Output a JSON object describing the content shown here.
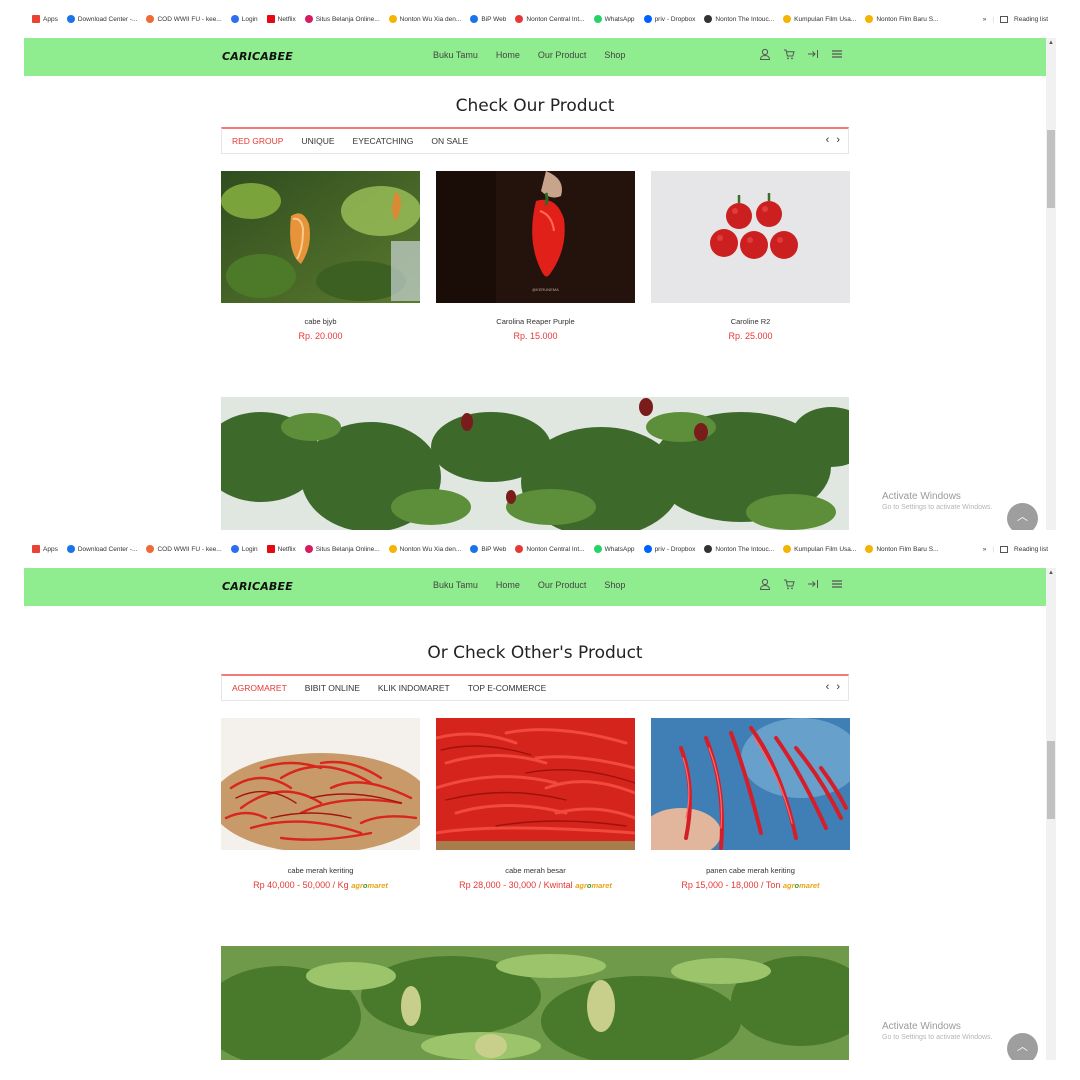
{
  "bookmarks": [
    {
      "label": "Apps",
      "icon": "apps-grid-icon",
      "color": "#ea4335"
    },
    {
      "label": "Download Center -...",
      "icon": "download-center-icon",
      "color": "#1a73e8"
    },
    {
      "label": "COD WWII FU - kee...",
      "icon": "cod-icon",
      "color": "#f06a35"
    },
    {
      "label": "Login",
      "icon": "login-icon",
      "color": "#2b6ef3"
    },
    {
      "label": "Netflix",
      "icon": "netflix-icon",
      "color": "#e50914"
    },
    {
      "label": "Situs Belanja Online...",
      "icon": "shop-icon",
      "color": "#d81b60"
    },
    {
      "label": "Nonton Wu Xia den...",
      "icon": "wuxia-icon",
      "color": "#f4b400"
    },
    {
      "label": "BiP Web",
      "icon": "bip-icon",
      "color": "#1a73e8"
    },
    {
      "label": "Nonton Central Int...",
      "icon": "central-icon",
      "color": "#e53935"
    },
    {
      "label": "WhatsApp",
      "icon": "whatsapp-icon",
      "color": "#25d366"
    },
    {
      "label": "priv - Dropbox",
      "icon": "dropbox-icon",
      "color": "#0061ff"
    },
    {
      "label": "Nonton The Intouc...",
      "icon": "intouch-icon",
      "color": "#333333"
    },
    {
      "label": "Kumpulan Film Usa...",
      "icon": "film-icon",
      "color": "#f4b400"
    },
    {
      "label": "Nonton Film Baru S...",
      "icon": "film-baru-icon",
      "color": "#f4b400"
    }
  ],
  "bookmarks_more": "»",
  "reading_list": "Reading list",
  "brand": "CARICABEE",
  "nav_links": [
    "Buku Tamu",
    "Home",
    "Our Product",
    "Shop"
  ],
  "nav_icons": [
    "user-icon",
    "cart-icon",
    "login-arrow-icon",
    "menu-icon"
  ],
  "activate": {
    "title": "Activate Windows",
    "sub": "Go to Settings to activate Windows."
  },
  "section1": {
    "title": "Check Our Product",
    "tabs": [
      "RED GROUP",
      "UNIQUE",
      "EYECATCHING",
      "ON SALE"
    ],
    "active_tab": 0,
    "products": [
      {
        "name": "cabe bjyb",
        "price": "Rp. 20.000",
        "image": "orange-pepper-on-plant"
      },
      {
        "name": "Carolina Reaper Purple",
        "price": "Rp. 15.000",
        "image": "red-reaper-held-dark-bg",
        "watermark": "@KERUNEMA"
      },
      {
        "name": "Caroline R2",
        "price": "Rp. 25.000",
        "image": "red-reapers-white-bg"
      }
    ]
  },
  "section2": {
    "title": "Or Check Other's Product",
    "tabs": [
      "AGROMARET",
      "BIBIT ONLINE",
      "KLIK INDOMARET",
      "TOP E-COMMERCE"
    ],
    "active_tab": 0,
    "products": [
      {
        "name": "cabe merah keriting",
        "price": "Rp 40,000 - 50,000 / Kg",
        "image": "pile-of-curly-red-chilies"
      },
      {
        "name": "cabe merah besar",
        "price": "Rp 28,000 - 30,000 / Kwintal",
        "image": "basket-of-red-chilies"
      },
      {
        "name": "panen cabe merah keriting",
        "price": "Rp 15,000 - 18,000 / Ton",
        "image": "hand-holding-red-chilies"
      }
    ],
    "store_logo": {
      "a": "agr",
      "b": "o",
      "c": "maret"
    }
  },
  "colors": {
    "navbar": "#8fed8f",
    "accent": "#e53935",
    "tab_border": "#f47a7a"
  }
}
